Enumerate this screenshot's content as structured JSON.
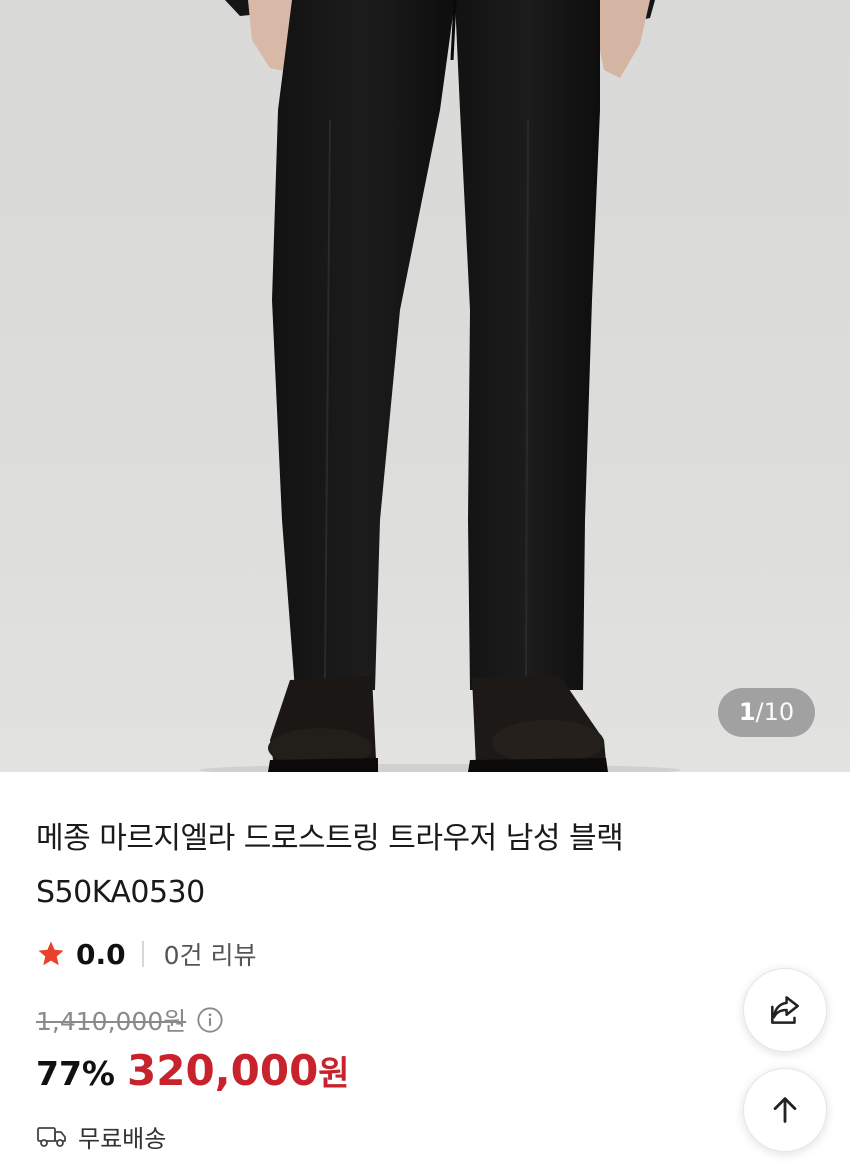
{
  "product": {
    "image_counter": {
      "current": "1",
      "separator": "/",
      "total": "10"
    },
    "title": "메종 마르지엘라 드로스트링 트라우저 남성 블랙 S50KA0530",
    "rating": {
      "score": "0.0",
      "reviews": "0건 리뷰"
    },
    "original_price": "1,410,000원",
    "discount": "77%",
    "sale_price": "320,000",
    "currency": "원",
    "shipping": "무료배송"
  },
  "colors": {
    "accent_red": "#c8232c",
    "star": "#e8412c"
  },
  "icons": [
    "star-icon",
    "info-icon",
    "truck-icon",
    "share-icon",
    "arrow-up-icon"
  ]
}
